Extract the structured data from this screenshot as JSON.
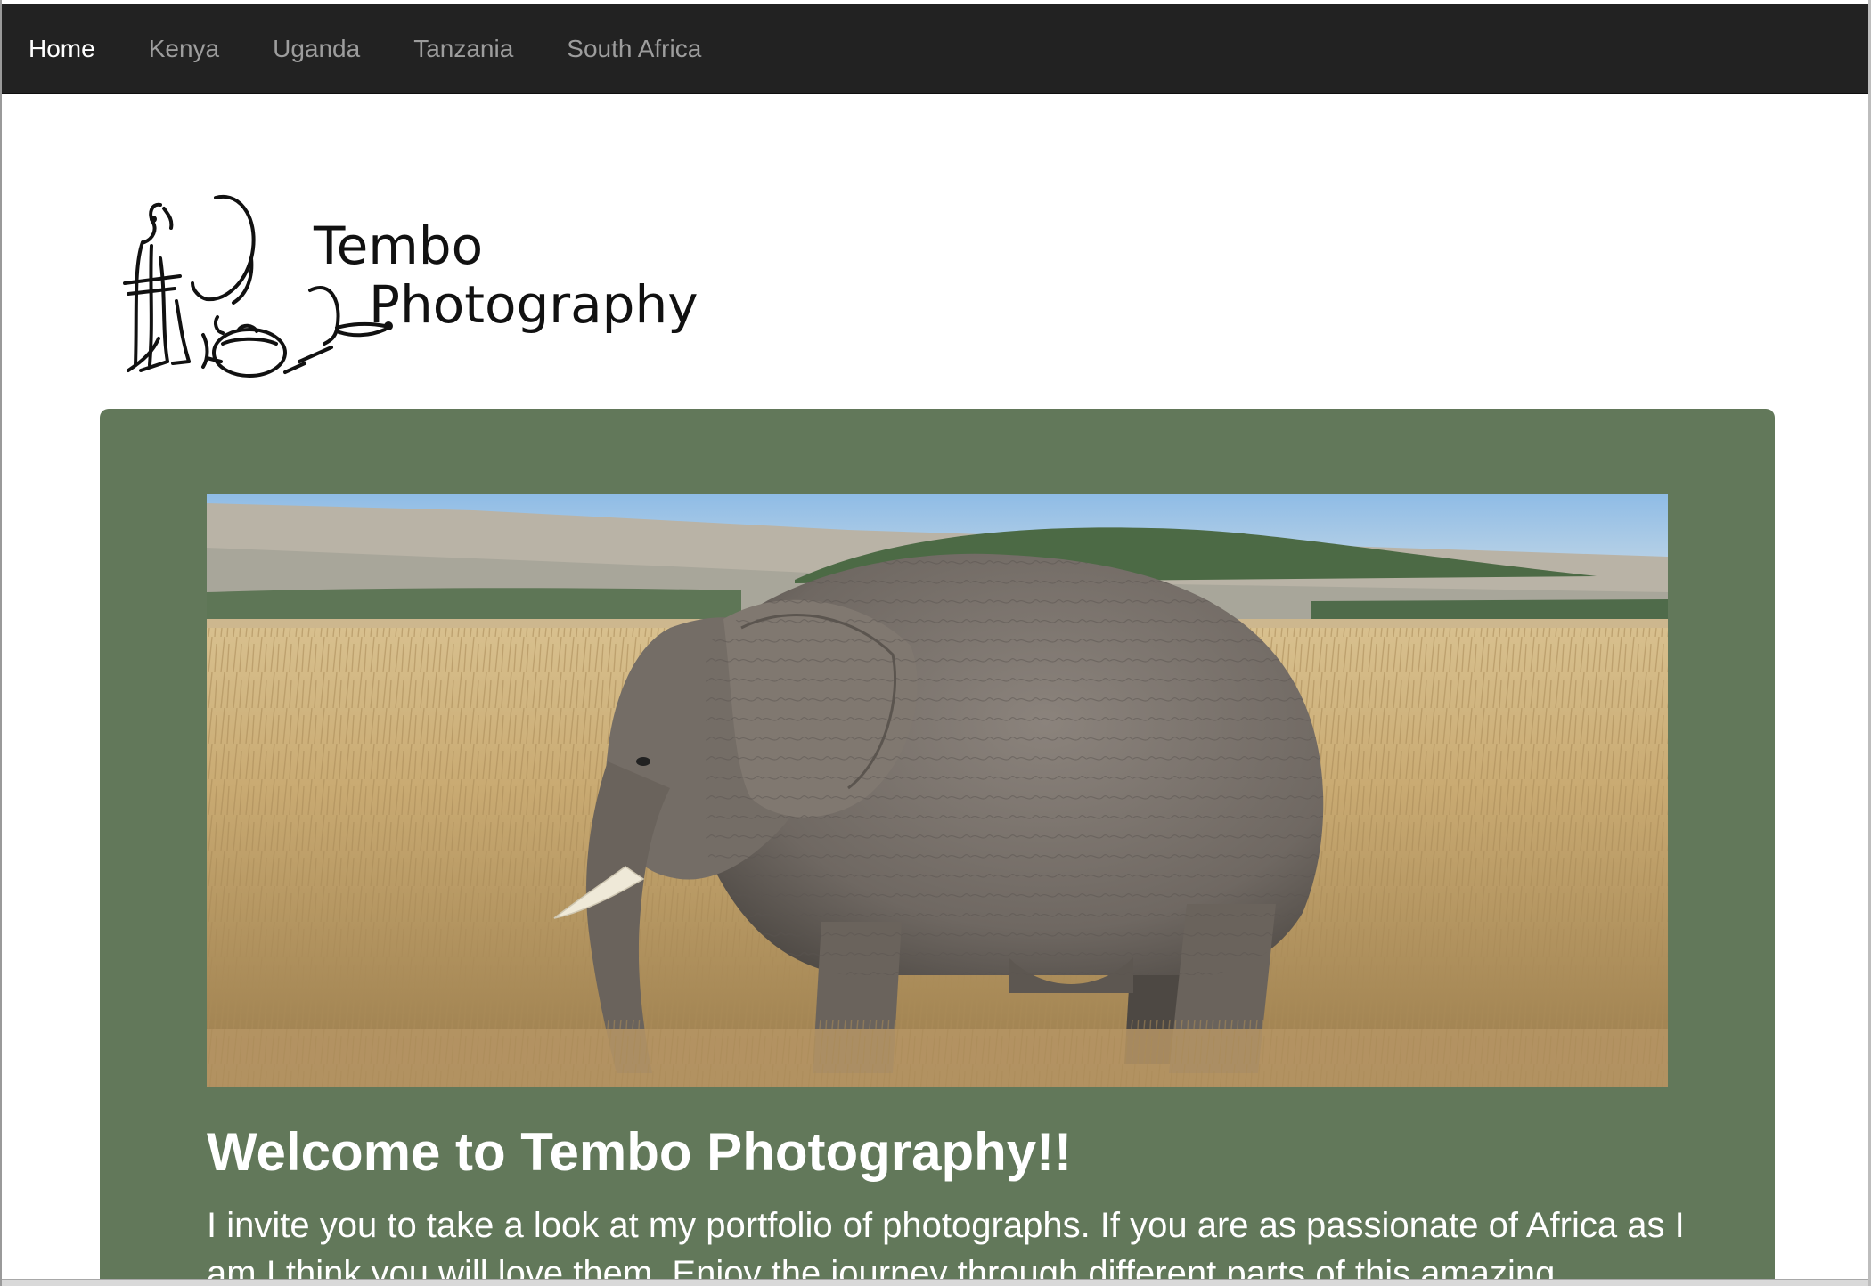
{
  "nav": {
    "items": [
      {
        "label": "Home",
        "active": true
      },
      {
        "label": "Kenya",
        "active": false
      },
      {
        "label": "Uganda",
        "active": false
      },
      {
        "label": "Tanzania",
        "active": false
      },
      {
        "label": "South Africa",
        "active": false
      }
    ]
  },
  "logo": {
    "line1": "Tembo",
    "line2": "Photography"
  },
  "hero": {
    "image": "elephant-in-savanna-photo"
  },
  "main": {
    "heading": "Welcome to Tembo Photography!!",
    "intro": "I invite you to take a look at my portfolio of photographs. If you are as passionate of Africa as I am I think you will love them. Enjoy the journey through different parts of this amazing"
  },
  "colors": {
    "navbar": "#222222",
    "nav_active": "#ffffff",
    "nav_inactive": "#9d9d9d",
    "jumbotron": "#62785a",
    "heading": "#ffffff"
  }
}
